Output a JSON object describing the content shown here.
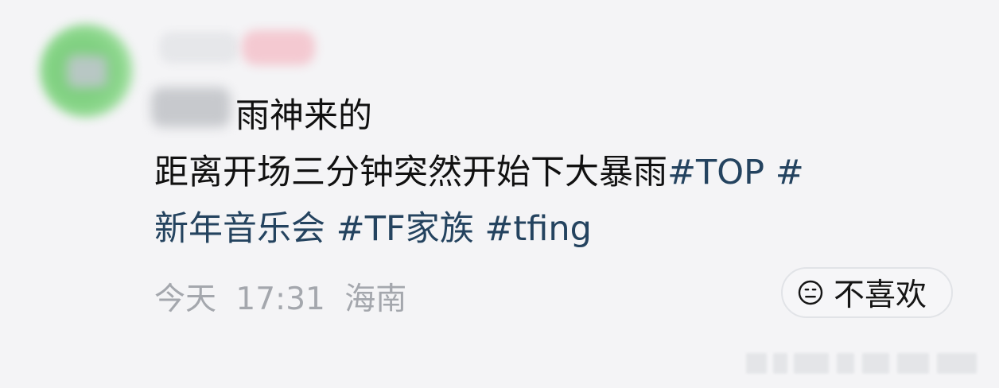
{
  "post": {
    "text_line_1": "雨神来的",
    "text_line_2_plain": "距离开场三分钟突然开始下大暴雨",
    "hashtag_1_part_1": "#TOP #",
    "hashtag_1_part_2": "新年音乐会",
    "hashtag_2": "#TF家族",
    "hashtag_3": "#tfing"
  },
  "meta": {
    "date": "今天",
    "time": "17:31",
    "location": "海南"
  },
  "actions": {
    "dislike_label": "不喜欢",
    "dislike_icon": "neutral-face-icon"
  },
  "colors": {
    "background": "#f4f4f6",
    "text": "#111111",
    "hashtag": "#24435f",
    "metadata": "#a4a7ad",
    "button_border": "#e1e3e7"
  }
}
